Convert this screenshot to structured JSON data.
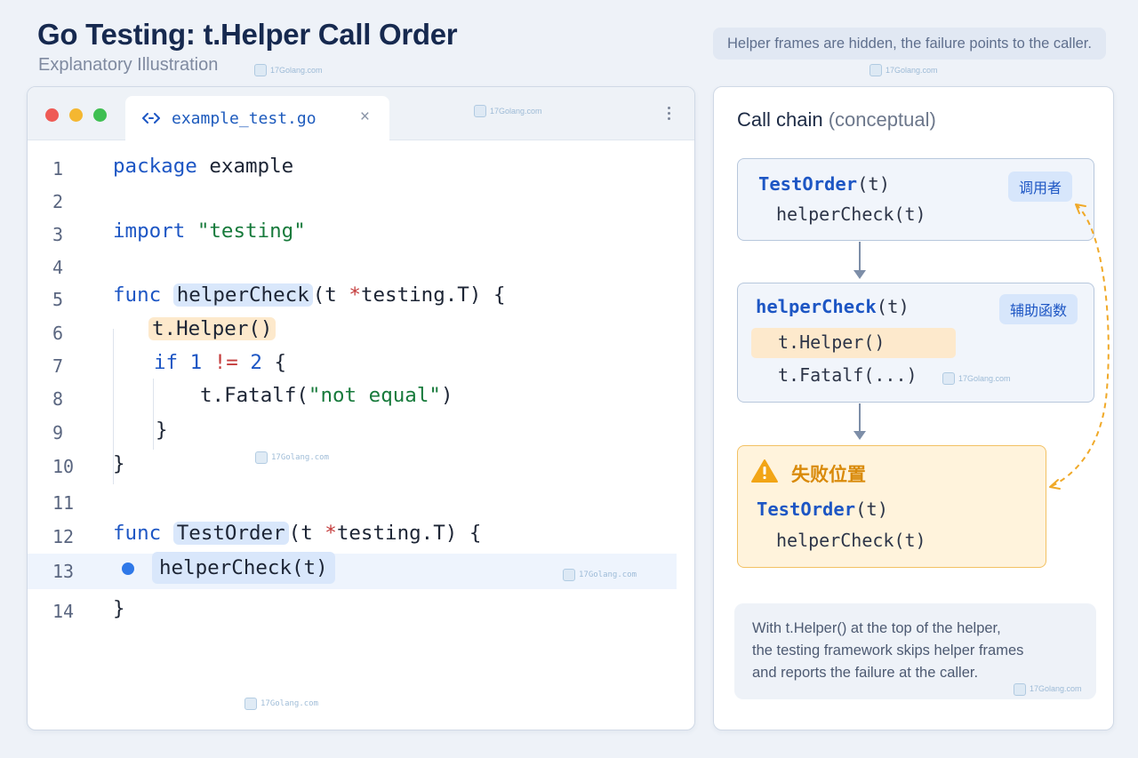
{
  "header": {
    "title": "Go Testing: t.Helper Call Order",
    "subtitle": "Explanatory Illustration",
    "note": "Helper frames are hidden, the failure points to the caller."
  },
  "watermark": "17Golang.com",
  "editor": {
    "tab_label": "example_test.go",
    "tab_close": "×",
    "line_numbers": [
      "1",
      "2",
      "3",
      "4",
      "5",
      "6",
      "7",
      "8",
      "9",
      "10",
      "11",
      "12",
      "13",
      "14"
    ],
    "code": {
      "l1_kw": "package",
      "l1_rest": " example",
      "l3_kw": "import",
      "l3_str": "\"testing\"",
      "l5_kw": "func",
      "l5_fn": "helperCheck",
      "l5_a": "(t ",
      "l5_star": "*",
      "l5_b": "testing.T) {",
      "l6_call": "t.Helper()",
      "l7_kw": "if",
      "l7_n1": "1",
      "l7_op": "!=",
      "l7_n2": "2",
      "l7_brace": " {",
      "l8_a": "t.Fatalf(",
      "l8_str": "\"not equal\"",
      "l8_b": ")",
      "l9": "}",
      "l10": "}",
      "l12_kw": "func",
      "l12_fn": "TestOrder",
      "l12_a": "(t ",
      "l12_star": "*",
      "l12_b": "testing.T) {",
      "l13_call": "helperCheck(t)",
      "l14": "}"
    }
  },
  "panel": {
    "title": "Call chain",
    "title_sub": "(conceptual)",
    "frame1": {
      "fn": "TestOrder",
      "args": "(t)",
      "line": "helperCheck(t)",
      "badge": "调用者"
    },
    "frame2": {
      "fn": "helperCheck",
      "args": "(t)",
      "line1": "t.Helper()",
      "line2": "t.Fatalf(...)",
      "badge": "辅助函数"
    },
    "frame3": {
      "label": "失败位置",
      "fn": "TestOrder",
      "args": "(t)",
      "line": "helperCheck(t)"
    },
    "explain": [
      "With t.Helper() at the top of the helper,",
      "the testing framework skips helper frames",
      "and reports the failure at the caller."
    ]
  },
  "colors": {
    "accent_blue": "#1d56c4",
    "string_green": "#177a3b",
    "highlight_orange": "#fde9cc",
    "warning": "#f2a516",
    "dot_red": "#ee5b55",
    "dot_yellow": "#f4b731",
    "dot_green": "#3fbf52"
  }
}
